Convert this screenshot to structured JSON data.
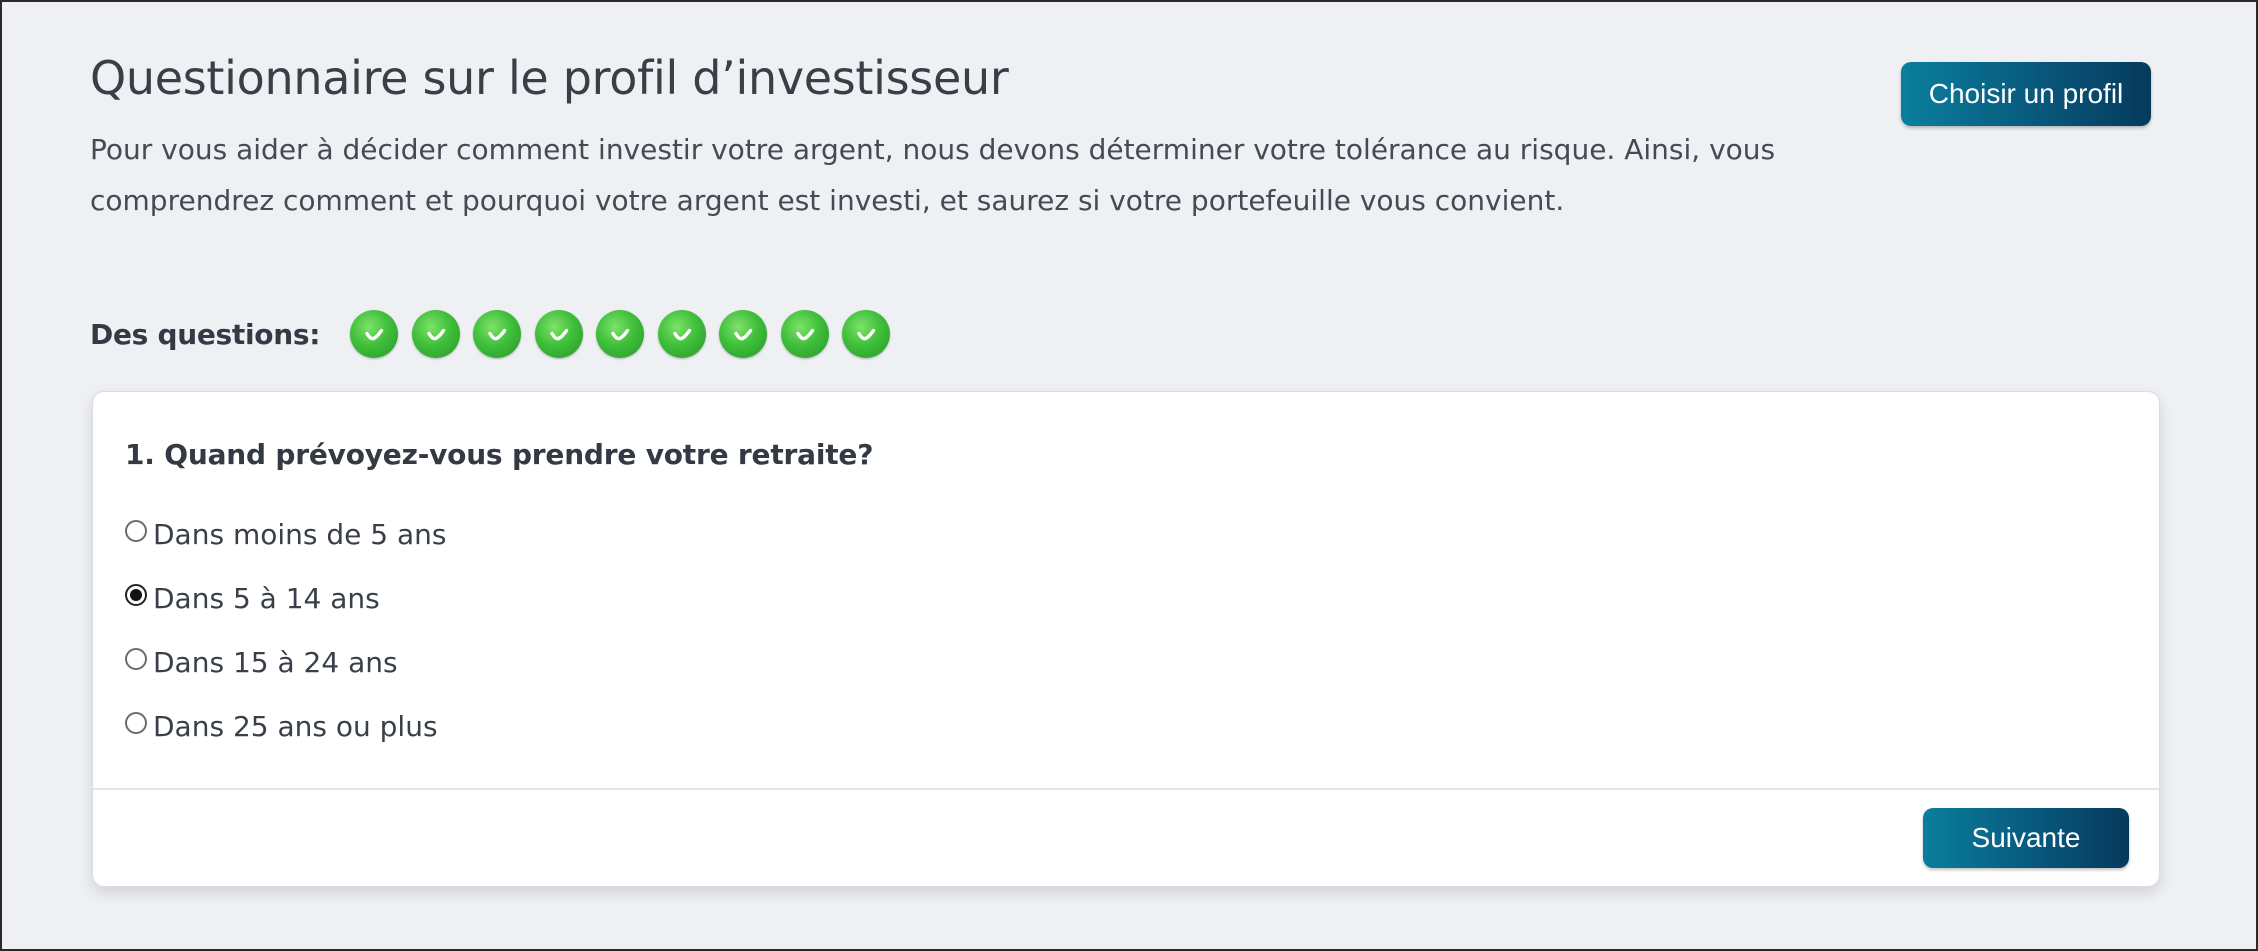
{
  "header": {
    "title": "Questionnaire sur le profil d’investisseur",
    "intro": "Pour vous aider à décider comment investir votre argent, nous devons déterminer votre tolérance au risque. Ainsi, vous comprendrez comment et pourquoi votre argent est investi, et saurez si votre portefeuille vous convient.",
    "choose_profile_label": "Choisir un profil"
  },
  "progress": {
    "label": "Des questions:",
    "steps": [
      {
        "status": "completed",
        "icon": "check-icon"
      },
      {
        "status": "completed",
        "icon": "check-icon"
      },
      {
        "status": "completed",
        "icon": "check-icon"
      },
      {
        "status": "completed",
        "icon": "check-icon"
      },
      {
        "status": "completed",
        "icon": "check-icon"
      },
      {
        "status": "completed",
        "icon": "check-icon"
      },
      {
        "status": "completed",
        "icon": "check-icon"
      },
      {
        "status": "completed",
        "icon": "check-icon"
      },
      {
        "status": "completed",
        "icon": "check-icon"
      }
    ],
    "completed_color": "#3fbf3a"
  },
  "question": {
    "title": "1. Quand prévoyez-vous prendre votre retraite?",
    "options": [
      {
        "label": "Dans moins de 5 ans",
        "selected": false
      },
      {
        "label": "Dans 5 à 14 ans",
        "selected": true
      },
      {
        "label": "Dans 15 à 24 ans",
        "selected": false
      },
      {
        "label": "Dans 25 ans ou plus",
        "selected": false
      }
    ]
  },
  "footer": {
    "next_label": "Suivante"
  },
  "colors": {
    "background": "#eef0f4",
    "button_start": "#0a7f9d",
    "button_end": "#063a5c",
    "card": "#ffffff"
  }
}
